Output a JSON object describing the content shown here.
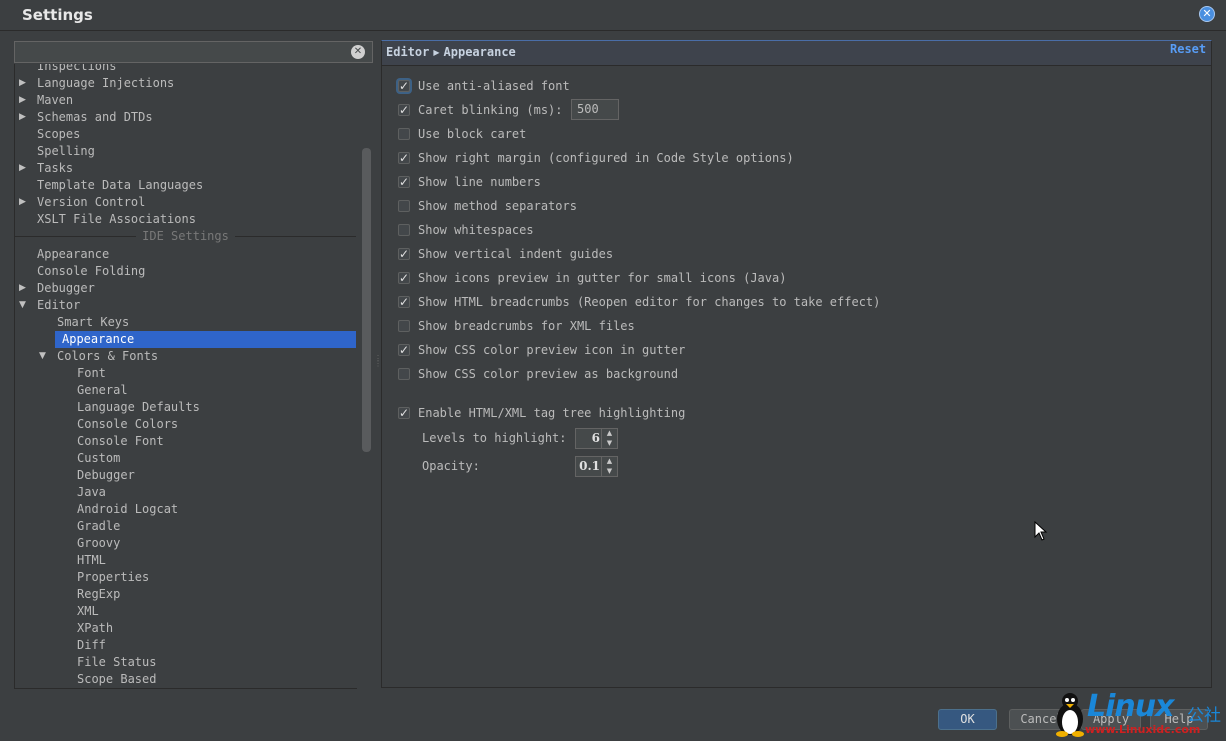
{
  "window": {
    "title": "Settings"
  },
  "search": {
    "value": "",
    "placeholder": ""
  },
  "tree": {
    "items": [
      {
        "label": "Inspections",
        "level": 0,
        "arrow": ""
      },
      {
        "label": "Language Injections",
        "level": 0,
        "arrow": "collapsed"
      },
      {
        "label": "Maven",
        "level": 0,
        "arrow": "collapsed"
      },
      {
        "label": "Schemas and DTDs",
        "level": 0,
        "arrow": "collapsed"
      },
      {
        "label": "Scopes",
        "level": 0,
        "arrow": ""
      },
      {
        "label": "Spelling",
        "level": 0,
        "arrow": ""
      },
      {
        "label": "Tasks",
        "level": 0,
        "arrow": "collapsed"
      },
      {
        "label": "Template Data Languages",
        "level": 0,
        "arrow": ""
      },
      {
        "label": "Version Control",
        "level": 0,
        "arrow": "collapsed"
      },
      {
        "label": "XSLT File Associations",
        "level": 0,
        "arrow": ""
      }
    ],
    "section_label": "IDE Settings",
    "ide_items": [
      {
        "label": "Appearance",
        "level": 0,
        "arrow": ""
      },
      {
        "label": "Console Folding",
        "level": 0,
        "arrow": ""
      },
      {
        "label": "Debugger",
        "level": 0,
        "arrow": "collapsed"
      },
      {
        "label": "Editor",
        "level": 0,
        "arrow": "expanded"
      },
      {
        "label": "Smart Keys",
        "level": 1,
        "arrow": ""
      },
      {
        "label": "Appearance",
        "level": 1,
        "arrow": "",
        "selected": true
      },
      {
        "label": "Colors & Fonts",
        "level": 1,
        "arrow": "expanded"
      },
      {
        "label": "Font",
        "level": 2,
        "arrow": ""
      },
      {
        "label": "General",
        "level": 2,
        "arrow": ""
      },
      {
        "label": "Language Defaults",
        "level": 2,
        "arrow": ""
      },
      {
        "label": "Console Colors",
        "level": 2,
        "arrow": ""
      },
      {
        "label": "Console Font",
        "level": 2,
        "arrow": ""
      },
      {
        "label": "Custom",
        "level": 2,
        "arrow": ""
      },
      {
        "label": "Debugger",
        "level": 2,
        "arrow": ""
      },
      {
        "label": "Java",
        "level": 2,
        "arrow": ""
      },
      {
        "label": "Android Logcat",
        "level": 2,
        "arrow": ""
      },
      {
        "label": "Gradle",
        "level": 2,
        "arrow": ""
      },
      {
        "label": "Groovy",
        "level": 2,
        "arrow": ""
      },
      {
        "label": "HTML",
        "level": 2,
        "arrow": ""
      },
      {
        "label": "Properties",
        "level": 2,
        "arrow": ""
      },
      {
        "label": "RegExp",
        "level": 2,
        "arrow": ""
      },
      {
        "label": "XML",
        "level": 2,
        "arrow": ""
      },
      {
        "label": "XPath",
        "level": 2,
        "arrow": ""
      },
      {
        "label": "Diff",
        "level": 2,
        "arrow": ""
      },
      {
        "label": "File Status",
        "level": 2,
        "arrow": ""
      },
      {
        "label": "Scope Based",
        "level": 2,
        "arrow": ""
      }
    ]
  },
  "breadcrumb": {
    "parent": "Editor",
    "current": "Appearance"
  },
  "reset_label": "Reset",
  "options": [
    {
      "label": "Use anti-aliased font",
      "checked": true
    },
    {
      "label": "Caret blinking (ms):",
      "checked": true
    },
    {
      "label": "Use block caret",
      "checked": false
    },
    {
      "label": "Show right margin (configured in Code Style options)",
      "checked": true
    },
    {
      "label": "Show line numbers",
      "checked": true
    },
    {
      "label": "Show method separators",
      "checked": false
    },
    {
      "label": "Show whitespaces",
      "checked": false
    },
    {
      "label": "Show vertical indent guides",
      "checked": true
    },
    {
      "label": "Show icons preview in gutter for small icons (Java)",
      "checked": true
    },
    {
      "label": "Show HTML breadcrumbs (Reopen editor for changes to take effect)",
      "checked": true
    },
    {
      "label": "Show breadcrumbs for XML files",
      "checked": false
    },
    {
      "label": "Show CSS color preview icon in gutter",
      "checked": true
    },
    {
      "label": "Show CSS color preview as background",
      "checked": false
    }
  ],
  "caret_blinking_value": "500",
  "tag_tree": {
    "label": "Enable HTML/XML tag tree highlighting",
    "checked": true,
    "levels_label": "Levels to highlight:",
    "levels_value": "6",
    "opacity_label": "Opacity:",
    "opacity_value": "0.1"
  },
  "buttons": {
    "ok": "OK",
    "cancel": "Cancel",
    "apply": "Apply",
    "help": "Help"
  },
  "watermark": {
    "brand": "Linux",
    "brand_cn": "公社",
    "url": "www.Linuxidc.com"
  },
  "colors": {
    "accent": "#2f65ca",
    "link": "#589df6",
    "background": "#3c3f41"
  }
}
